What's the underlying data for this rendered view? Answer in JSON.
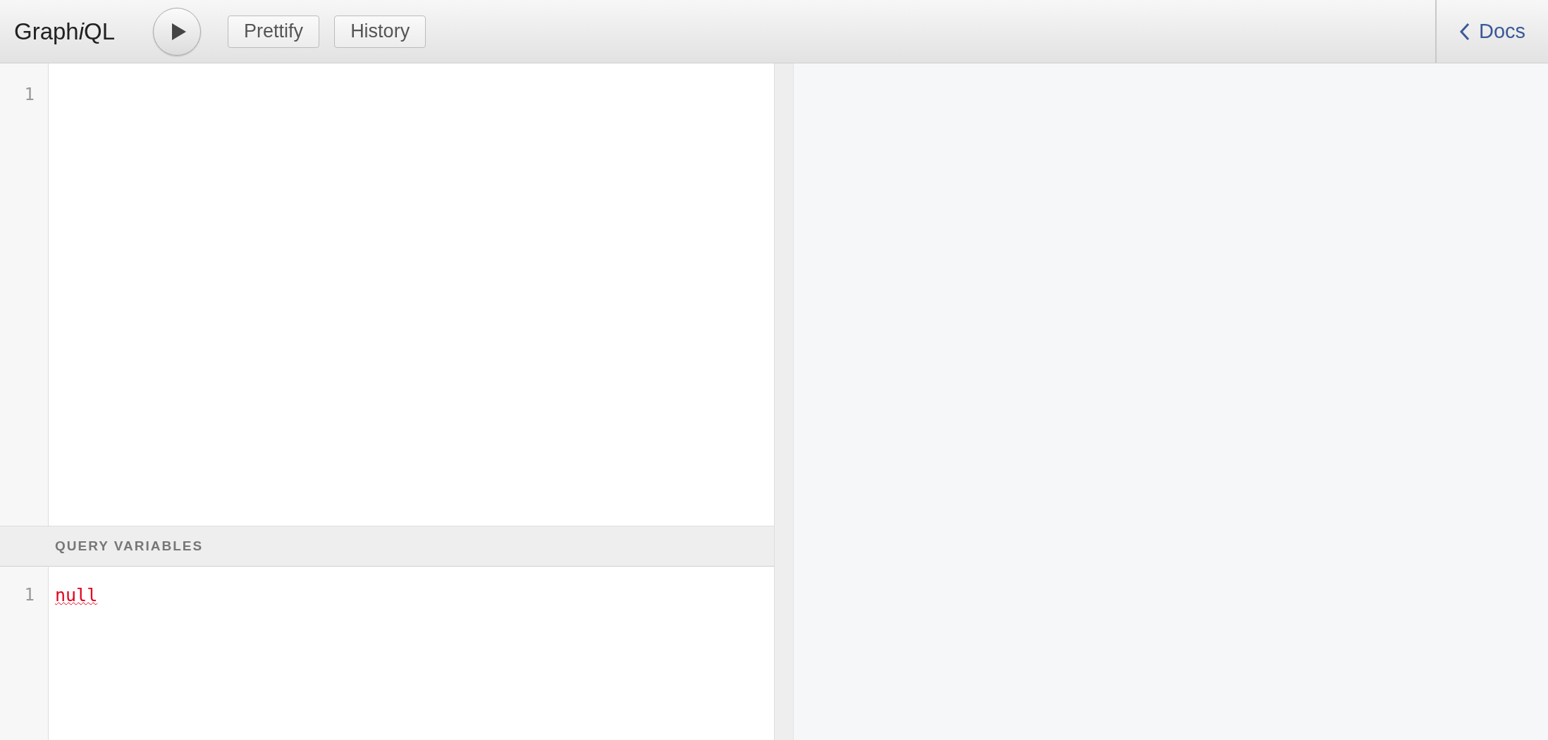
{
  "toolbar": {
    "logo": [
      {
        "text": "Graph",
        "italic": false
      },
      {
        "text": "i",
        "italic": true
      },
      {
        "text": "QL",
        "italic": false
      }
    ],
    "buttons": [
      {
        "label": "Prettify"
      },
      {
        "label": "History"
      }
    ],
    "docs": "Docs"
  },
  "query_editor": {
    "line_numbers": [
      "1"
    ]
  },
  "variables_editor": {
    "title": "QUERY VARIABLES",
    "lines": [
      {
        "number": "1",
        "text": "null",
        "error": true
      }
    ]
  }
}
